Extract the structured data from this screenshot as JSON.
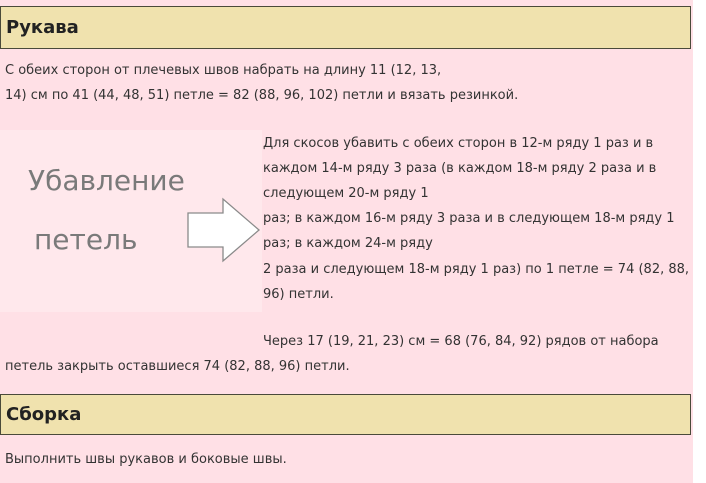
{
  "section1": {
    "title": "Рукава",
    "intro_line1": "С обеих сторон от плечевых швов набрать на длину 11 (12, 13,",
    "intro_line2": "14) см по 41 (44, 48, 51) петле = 82 (88, 96, 102) петли и вязать резинкой.",
    "figure": {
      "caption_line1": "Убавление",
      "caption_line2": "петель",
      "arrow_icon": "right-arrow-outline"
    },
    "decrease_lines": [
      "Для скосов убавить с обеих сторон в 12-м ряду 1 раз и в",
      "каждом 14-м ряду 3 раза (в каждом 18-м ряду 2 раза и в",
      "следующем 20-м ряду 1",
      "раз; в каждом 16-м ряду 3 раза и в следующем 18-м ряду 1",
      "раз; в каждом 24-м ряду",
      "2 раза и следующем 18-м ряду 1 раз) по 1 петле = 74 (82, 88,",
      "96) петли."
    ],
    "close_line1": "Через 17 (19, 21, 23) см = 68 (76, 84, 92) рядов от набора",
    "close_line2": "петель закрыть оставшиеся 74 (82, 88, 96) петли."
  },
  "section2": {
    "title": "Сборка",
    "text": "Выполнить швы рукавов и боковые швы."
  }
}
